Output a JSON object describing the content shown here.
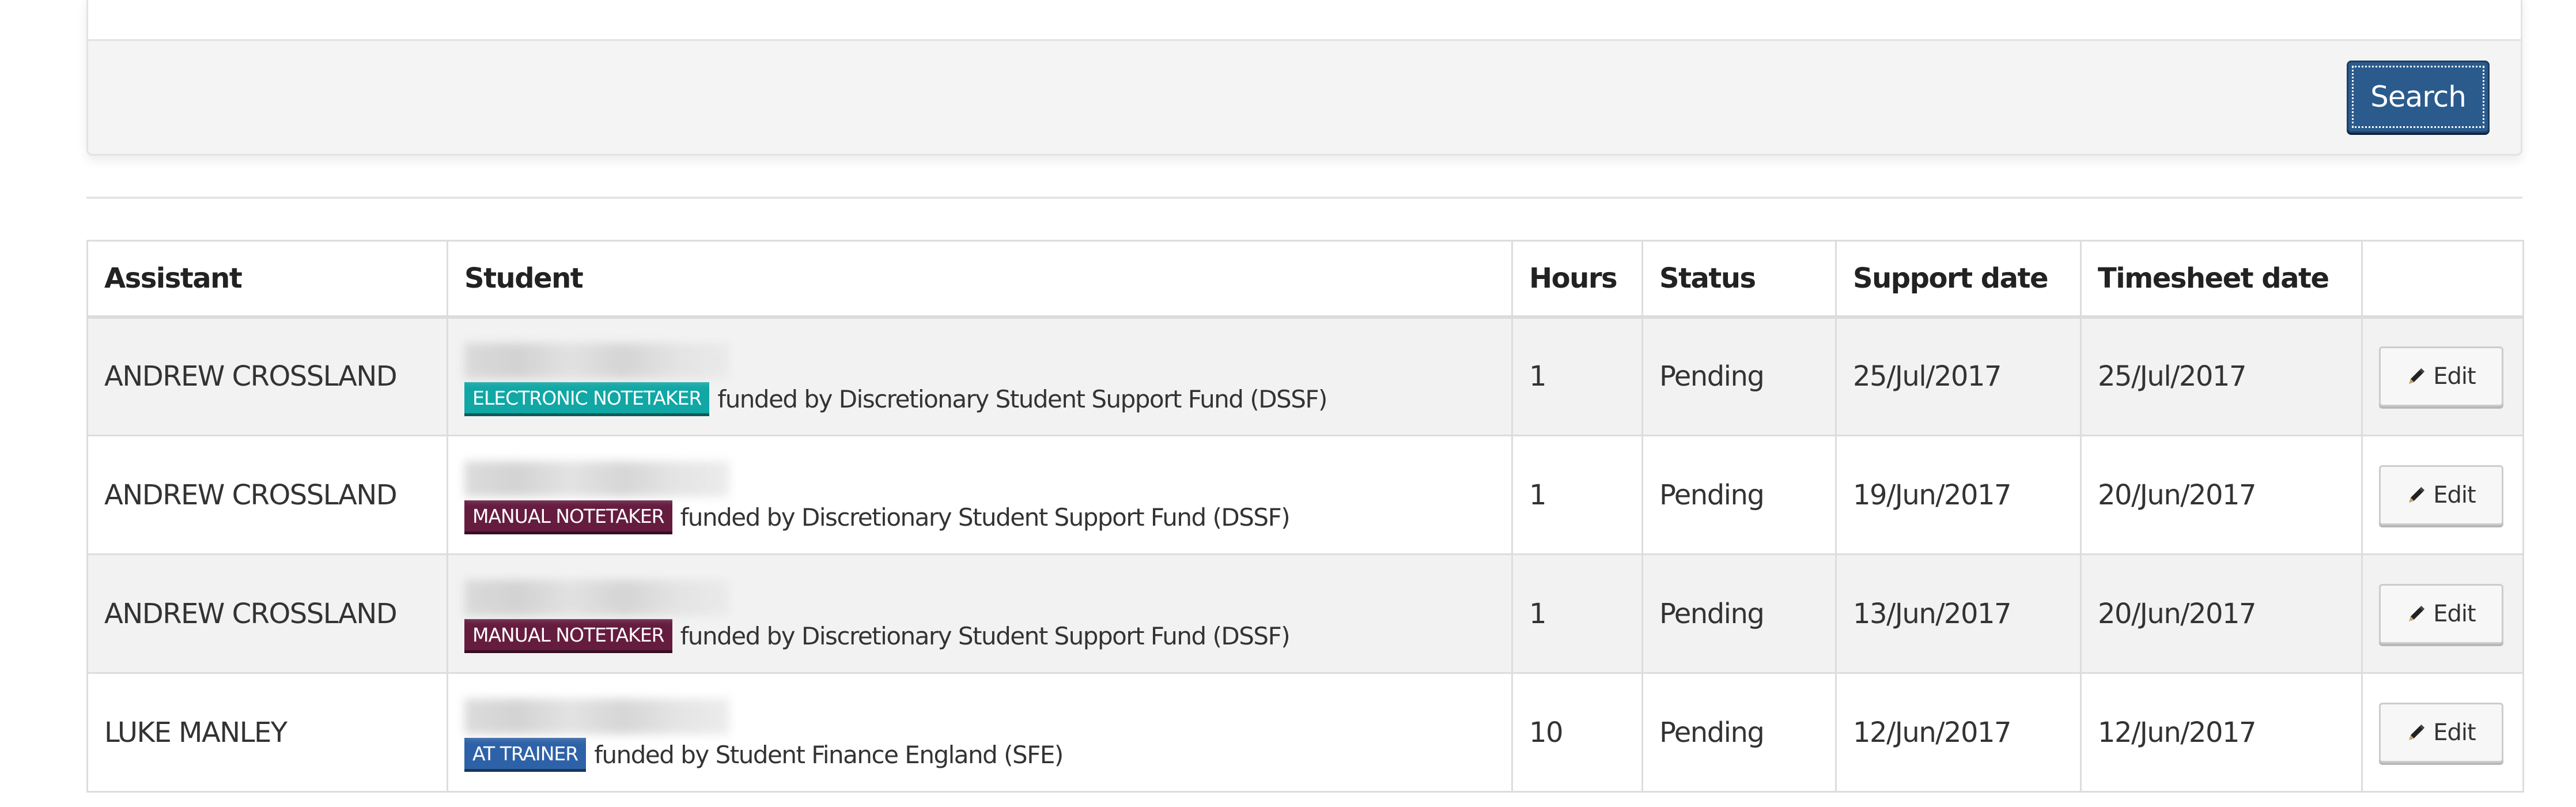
{
  "search_panel": {
    "search_button_label": "Search"
  },
  "table": {
    "columns": [
      "Assistant",
      "Student",
      "Hours",
      "Status",
      "Support date",
      "Timesheet date",
      ""
    ],
    "rows": [
      {
        "assistant": "ANDREW CROSSLAND",
        "student_name": "[redacted]",
        "service_badge": "ELECTRONIC NOTETAKER",
        "badge_color": "#10a7a5",
        "funding": "funded by Discretionary Student Support Fund (DSSF)",
        "hours": "1",
        "status": "Pending",
        "support_date": "25/Jul/2017",
        "timesheet_date": "25/Jul/2017",
        "action_label": "Edit"
      },
      {
        "assistant": "ANDREW CROSSLAND",
        "student_name": "[redacted]",
        "service_badge": "MANUAL NOTETAKER",
        "badge_color": "#651c3f",
        "funding": "funded by Discretionary Student Support Fund (DSSF)",
        "hours": "1",
        "status": "Pending",
        "support_date": "19/Jun/2017",
        "timesheet_date": "20/Jun/2017",
        "action_label": "Edit"
      },
      {
        "assistant": "ANDREW CROSSLAND",
        "student_name": "[redacted]",
        "service_badge": "MANUAL NOTETAKER",
        "badge_color": "#651c3f",
        "funding": "funded by Discretionary Student Support Fund (DSSF)",
        "hours": "1",
        "status": "Pending",
        "support_date": "13/Jun/2017",
        "timesheet_date": "20/Jun/2017",
        "action_label": "Edit"
      },
      {
        "assistant": "LUKE MANLEY",
        "student_name": "[redacted]",
        "service_badge": "AT TRAINER",
        "badge_color": "#2e62a8",
        "funding": "funded by Student Finance England (SFE)",
        "hours": "10",
        "status": "Pending",
        "support_date": "12/Jun/2017",
        "timesheet_date": "12/Jun/2017",
        "action_label": "Edit"
      }
    ]
  },
  "colors": {
    "primary_button": "#2b5b8d",
    "panel_footer": "#f4f4f4",
    "row_stripe": "#f2f2f2"
  }
}
